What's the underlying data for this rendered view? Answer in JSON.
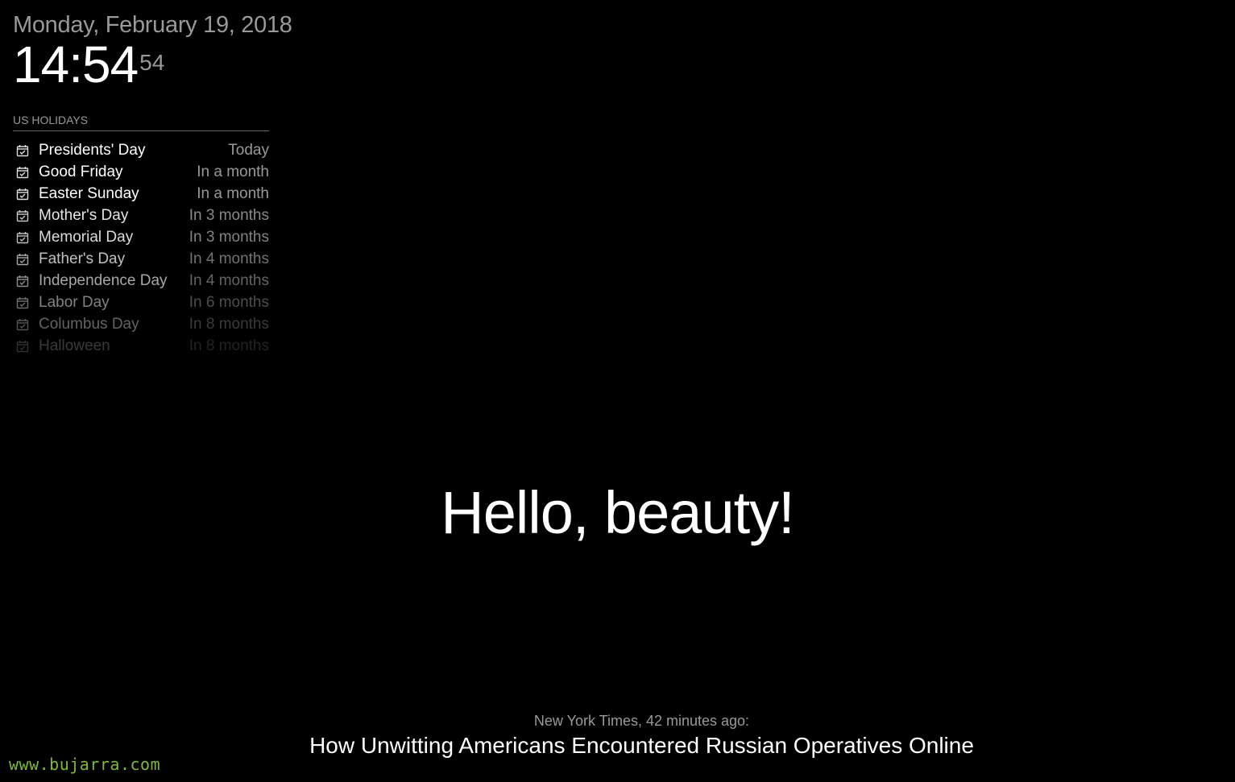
{
  "clock": {
    "date": "Monday, February 19, 2018",
    "time": "14:54",
    "seconds": "54"
  },
  "calendar": {
    "header": "US HOLIDAYS",
    "icon": "calendar-check-icon",
    "events": [
      {
        "title": "Presidents' Day",
        "time": "Today",
        "opacity": 1.0
      },
      {
        "title": "Good Friday",
        "time": "In a month",
        "opacity": 1.0
      },
      {
        "title": "Easter Sunday",
        "time": "In a month",
        "opacity": 1.0
      },
      {
        "title": "Mother's Day",
        "time": "In 3 months",
        "opacity": 0.9
      },
      {
        "title": "Memorial Day",
        "time": "In 3 months",
        "opacity": 0.85
      },
      {
        "title": "Father's Day",
        "time": "In 4 months",
        "opacity": 0.75
      },
      {
        "title": "Independence Day",
        "time": "In 4 months",
        "opacity": 0.65
      },
      {
        "title": "Labor Day",
        "time": "In 6 months",
        "opacity": 0.5
      },
      {
        "title": "Columbus Day",
        "time": "In 8 months",
        "opacity": 0.38
      },
      {
        "title": "Halloween",
        "time": "In 8 months",
        "opacity": 0.22
      }
    ]
  },
  "compliment": {
    "text": "Hello, beauty!"
  },
  "news": {
    "source": "New York Times, 42 minutes ago:",
    "headline": "How Unwitting Americans Encountered Russian Operatives Online"
  },
  "watermark": {
    "text": "www.bujarra.com",
    "color": "#7cba3a"
  },
  "colors": {
    "background": "#000000",
    "primary_text": "#ffffff",
    "dimmed_text": "#999999"
  }
}
